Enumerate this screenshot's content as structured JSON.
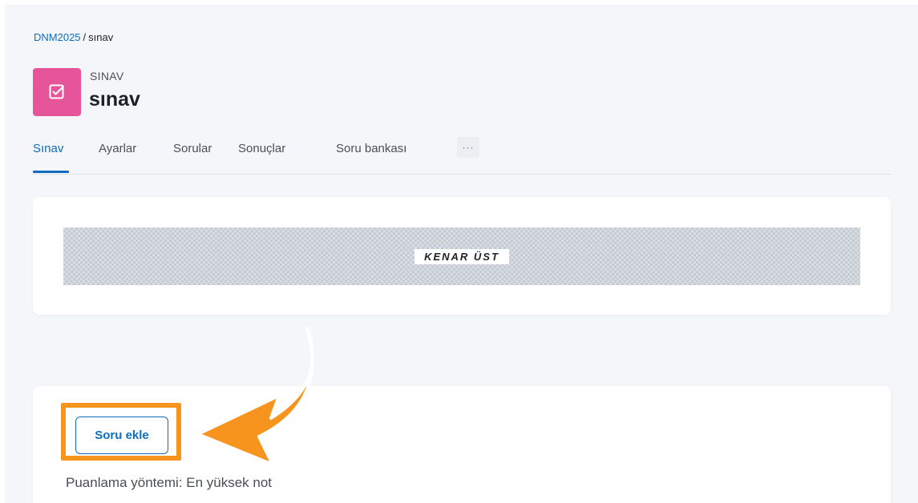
{
  "breadcrumb": {
    "course": "DNM2025",
    "separator": "/",
    "current": "sınav"
  },
  "module": {
    "type_label": "SINAV",
    "title": "sınav",
    "icon": "quiz-checkbox-icon",
    "icon_color": "#e6559a"
  },
  "tabs": [
    {
      "label": "Sınav",
      "active": true
    },
    {
      "label": "Ayarlar"
    },
    {
      "label": "Sorular"
    },
    {
      "label": "Sonuçlar"
    },
    {
      "label": "Soru bankası"
    }
  ],
  "more_tab": {
    "label": "···"
  },
  "block_region": {
    "label": "KENAR ÜST"
  },
  "actions": {
    "add_question_label": "Soru ekle"
  },
  "grading": {
    "text": "Puanlama yöntemi: En yüksek not"
  },
  "colors": {
    "accent": "#0f6cbf",
    "highlight": "#f7941d",
    "page_bg": "#f5f6fa"
  }
}
